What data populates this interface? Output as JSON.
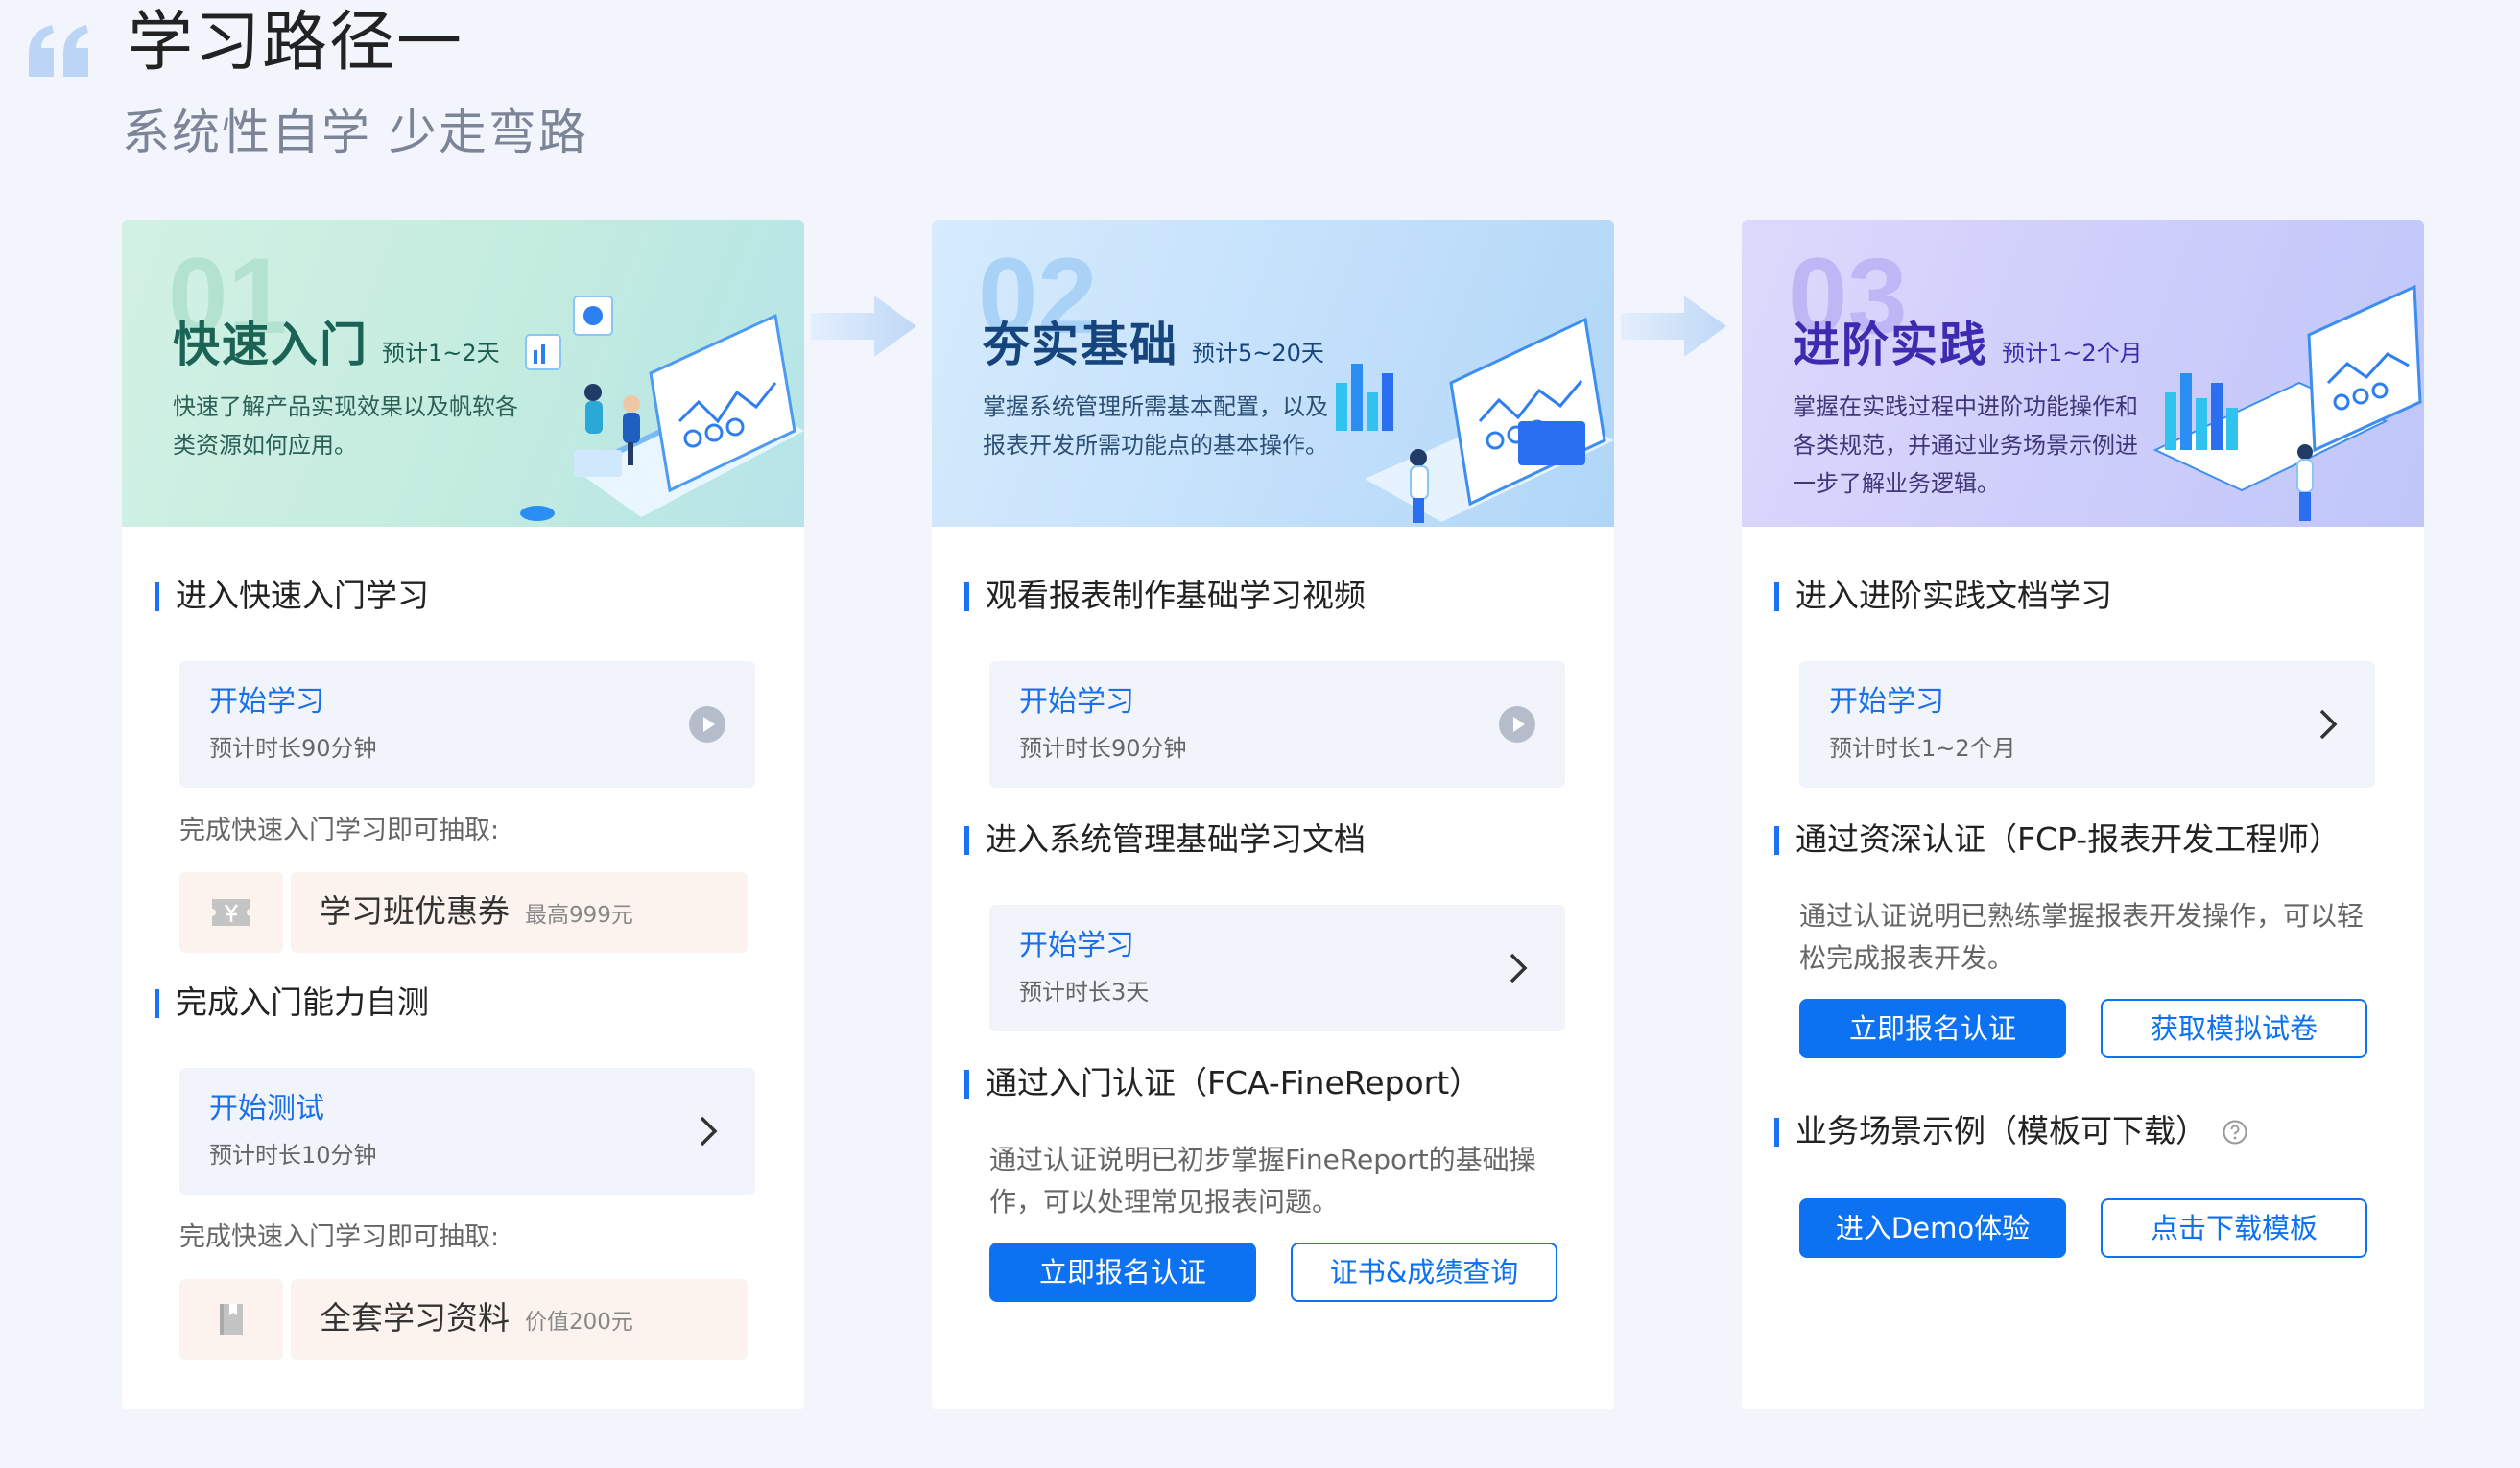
{
  "page": {
    "title": "学习路径一",
    "subtitle": "系统性自学 少走弯路"
  },
  "colors": {
    "accent": "#0d72f2",
    "step1_title": "#1b6355",
    "step2_title": "#15457c",
    "step3_title": "#3c2ab0"
  },
  "steps": [
    {
      "num": "01",
      "title": "快速入门",
      "estimate": "预计1~2天",
      "desc": "快速了解产品实现效果以及帆软各类资源如何应用。",
      "sec1": "进入快速入门学习",
      "entry1": {
        "label": "开始学习",
        "sub": "预计时长90分钟",
        "icon": "play-circle-icon"
      },
      "note1": "完成快速入门学习即可抽取:",
      "reward1": {
        "name": "学习班优惠券",
        "note": "最高999元",
        "icon": "ticket-icon"
      },
      "sec2": "完成入门能力自测",
      "entry2": {
        "label": "开始测试",
        "sub": "预计时长10分钟",
        "icon": "chevron-right-icon"
      },
      "note2": "完成快速入门学习即可抽取:",
      "reward2": {
        "name": "全套学习资料",
        "note": "价值200元",
        "icon": "book-icon"
      }
    },
    {
      "num": "02",
      "title": "夯实基础",
      "estimate": "预计5~20天",
      "desc": "掌握系统管理所需基本配置，以及报表开发所需功能点的基本操作。",
      "sec1": "观看报表制作基础学习视频",
      "entry1": {
        "label": "开始学习",
        "sub": "预计时长90分钟",
        "icon": "play-circle-icon"
      },
      "sec2": "进入系统管理基础学习文档",
      "entry2": {
        "label": "开始学习",
        "sub": "预计时长3天",
        "icon": "chevron-right-icon"
      },
      "sec3": "通过入门认证（FCA-FineReport）",
      "para": "通过认证说明已初步掌握FineReport的基础操作，可以处理常见报表问题。",
      "btn_primary": "立即报名认证",
      "btn_outline": "证书&成绩查询"
    },
    {
      "num": "03",
      "title": "进阶实践",
      "estimate": "预计1~2个月",
      "desc": "掌握在实践过程中进阶功能操作和各类规范，并通过业务场景示例进一步了解业务逻辑。",
      "sec1": "进入进阶实践文档学习",
      "entry1": {
        "label": "开始学习",
        "sub": "预计时长1~2个月",
        "icon": "chevron-right-icon"
      },
      "sec2": "通过资深认证（FCP-报表开发工程师）",
      "para": "通过认证说明已熟练掌握报表开发操作，可以轻松完成报表开发。",
      "btn_primary": "立即报名认证",
      "btn_outline": "获取模拟试卷",
      "sec3": "业务场景示例（模板可下载）",
      "btn_primary2": "进入Demo体验",
      "btn_outline2": "点击下载模板"
    }
  ]
}
